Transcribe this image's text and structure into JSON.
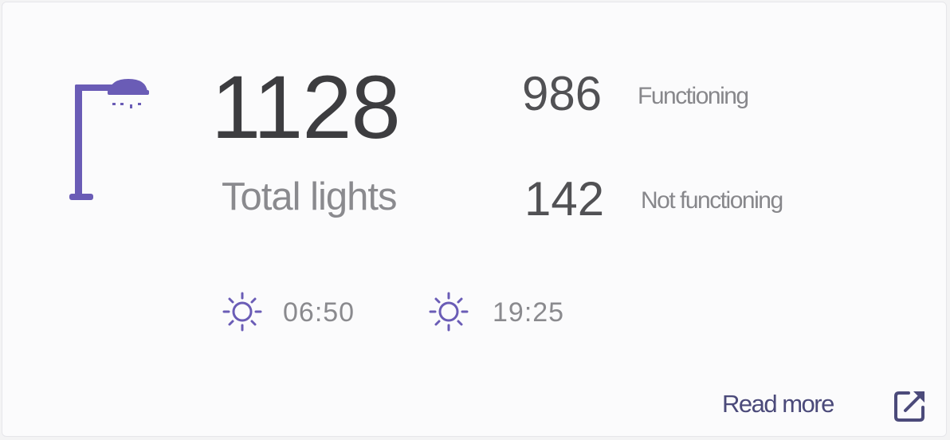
{
  "lights": {
    "total_value": "1128",
    "total_label": "Total lights",
    "functioning_value": "986",
    "functioning_label": "Functioning",
    "not_functioning_value": "142",
    "not_functioning_label": "Not functioning"
  },
  "sun": {
    "sunrise_time": "06:50",
    "sunset_time": "19:25"
  },
  "footer": {
    "read_more_label": "Read more"
  },
  "colors": {
    "accent": "#6a5cb6",
    "text_dark": "#3d3d40",
    "text_muted": "#8a8a8e",
    "link": "#4b4a7a"
  },
  "icons": {
    "lamp": "street-lamp-icon",
    "sunrise": "sun-icon",
    "sunset": "sun-icon",
    "external": "external-link-icon"
  }
}
